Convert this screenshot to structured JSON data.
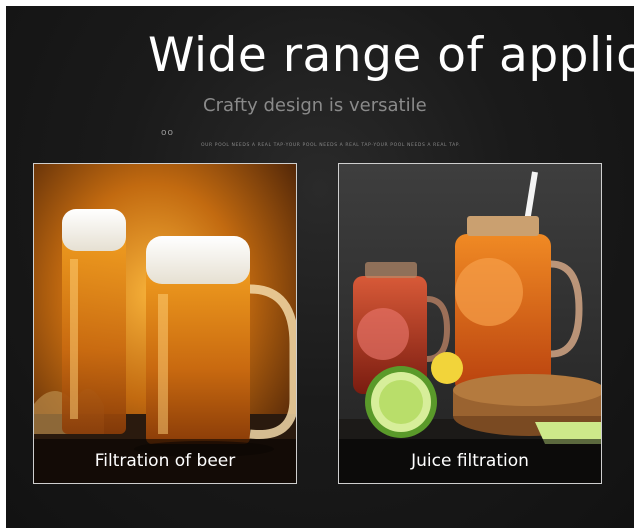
{
  "banner": {
    "title": "Wide range of applicat",
    "subtitle": "Crafty design is versatile",
    "dots": "oo",
    "tagline": "OUR POOL NEEDS A REAL TAP·YOUR POOL NEEDS A REAL TAP·YOUR POOL NEEDS A REAL TAP."
  },
  "cards": [
    {
      "caption": "Filtration of beer",
      "image": "beer-mugs-photo"
    },
    {
      "caption": "Juice filtration",
      "image": "juice-jars-photo"
    }
  ],
  "colors": {
    "background": "#161616",
    "title": "#ffffff",
    "subtitle": "#8a8a8a",
    "beer": "#e08a18",
    "juice": "#e2621a"
  }
}
